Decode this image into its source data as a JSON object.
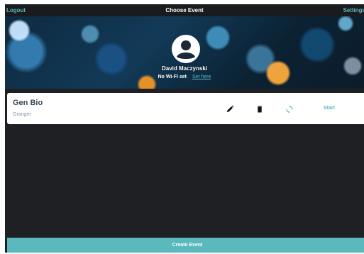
{
  "topbar": {
    "left_action": "Logout",
    "title": "Choose Event",
    "right_action": "Settings"
  },
  "user": {
    "name": "David Maczynski",
    "wifi_status": "No Wi-Fi set",
    "wifi_link": "Set here",
    "avatar_icon": "account-circle-icon"
  },
  "events": [
    {
      "title": "Gen Bio",
      "subtitle": "Granger",
      "actions": {
        "edit_icon": "pencil-icon",
        "delete_icon": "trash-icon",
        "refresh_icon": "sync-icon",
        "start_label": "Start"
      }
    }
  ],
  "footer": {
    "create_label": "Create Event"
  },
  "colors": {
    "accent": "#5ab8c7",
    "button": "#5bb8bd",
    "background": "#1f2023",
    "card": "#ffffff"
  }
}
